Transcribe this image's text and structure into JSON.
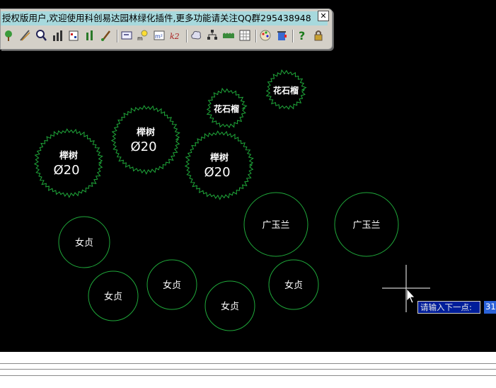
{
  "toolbar": {
    "title": "授权版用户,欢迎使用科创易达园林绿化插件,更多功能请关注QQ群295438948",
    "close_symbol": "✕",
    "tool_icons": [
      "tree-planting-icon",
      "pen-line-icon",
      "search-zoom-icon",
      "bar-chart-icon",
      "stats-table-icon",
      "tree-row-icon",
      "brush-icon",
      "rectangle-icon",
      "bulb-area-icon",
      "area-m2-icon",
      "formula-icon",
      "cloud-shape-icon",
      "hierarchy-icon",
      "hedge-row-icon",
      "grid-count-icon",
      "palette-icon",
      "paint-bucket-icon",
      "help-icon",
      "lock-icon"
    ]
  },
  "plants": [
    {
      "kind": "shrub-canopy",
      "name": "榉树",
      "size": "Ø20"
    },
    {
      "kind": "shrub-canopy",
      "name": "榉树",
      "size": "Ø20"
    },
    {
      "kind": "shrub-canopy",
      "name": "榉树",
      "size": "Ø20"
    },
    {
      "kind": "shrub-canopy",
      "name": "花石榴",
      "size": ""
    },
    {
      "kind": "shrub-canopy",
      "name": "花石榴",
      "size": ""
    },
    {
      "kind": "circle",
      "name": "广玉兰",
      "size": ""
    },
    {
      "kind": "circle",
      "name": "广玉兰",
      "size": ""
    },
    {
      "kind": "circle",
      "name": "女贞",
      "size": ""
    },
    {
      "kind": "circle",
      "name": "女贞",
      "size": ""
    },
    {
      "kind": "circle",
      "name": "女贞",
      "size": ""
    },
    {
      "kind": "circle",
      "name": "女贞",
      "size": ""
    },
    {
      "kind": "circle",
      "name": "女贞",
      "size": ""
    }
  ],
  "command": {
    "prompt": "请输入下一点:",
    "input_value": "31"
  },
  "colors": {
    "drawing_background": "#000000",
    "plant_outline": "#1fa83a",
    "label_text": "#ffffff",
    "toolbar_title_bg": "#a7d9dd"
  }
}
